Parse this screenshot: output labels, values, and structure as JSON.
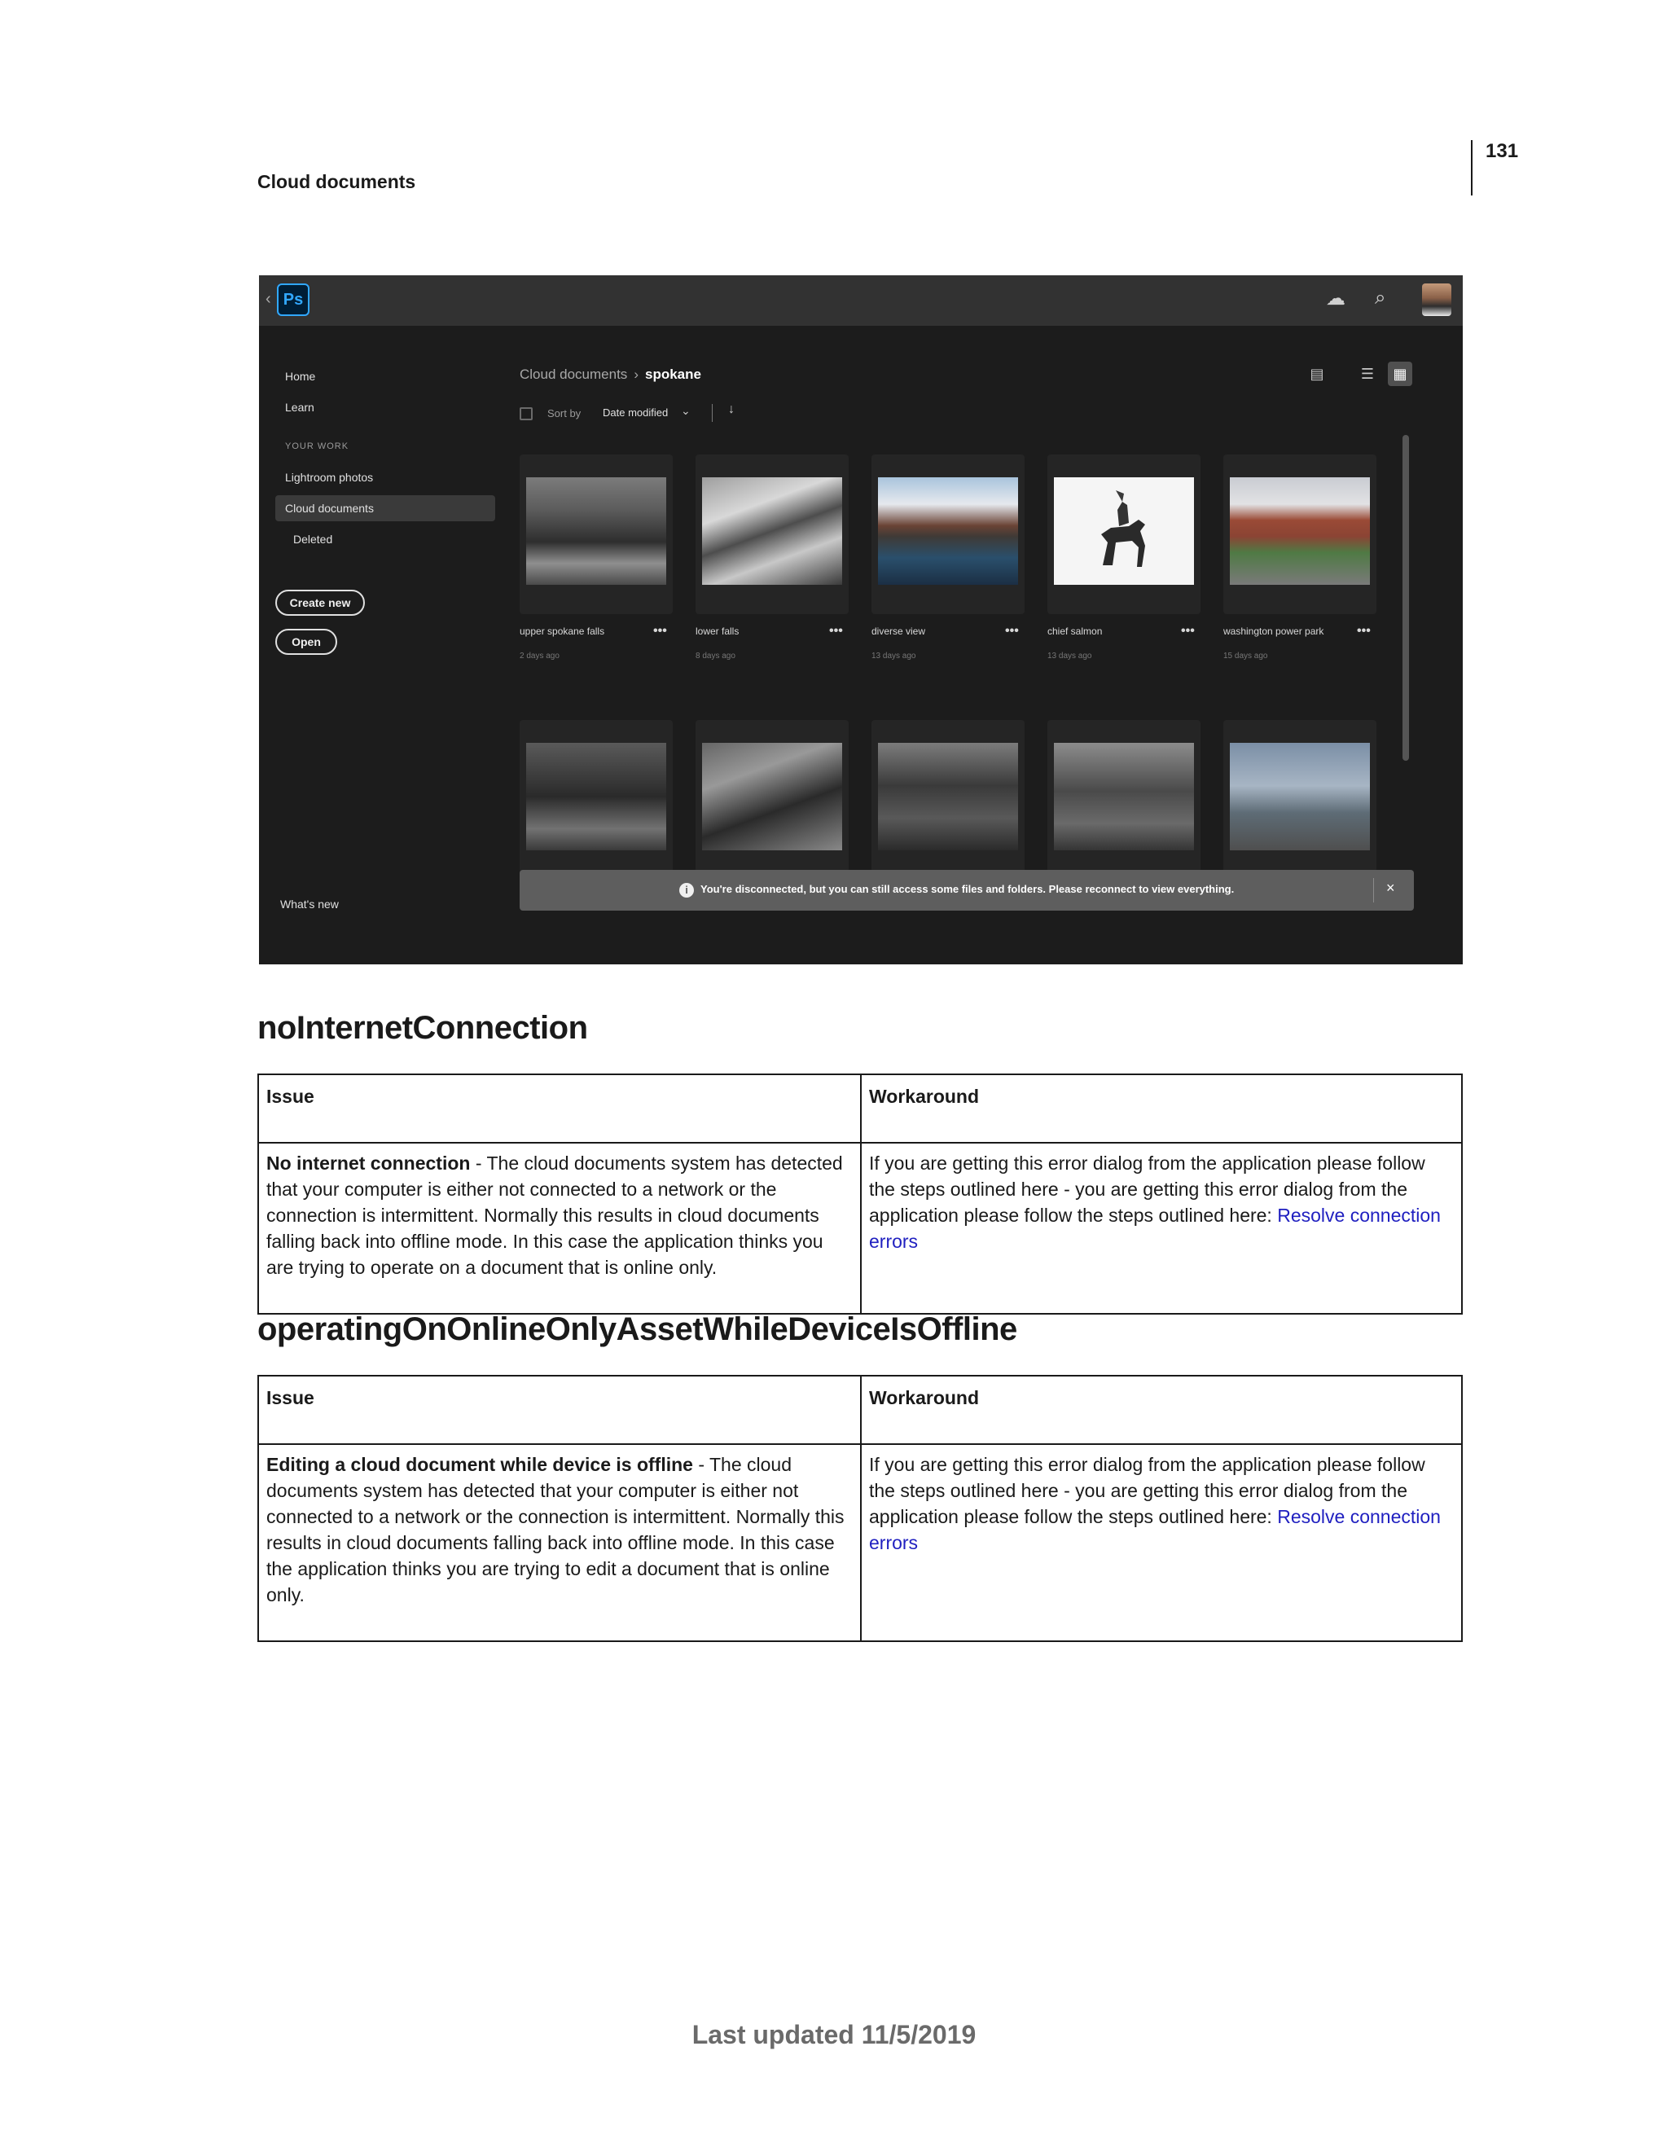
{
  "page": {
    "number": "131",
    "running_head": "Cloud documents",
    "footer": "Last updated 11/5/2019"
  },
  "screenshot": {
    "app_logo": "Ps",
    "sidebar": {
      "home": "Home",
      "learn": "Learn",
      "section": "YOUR WORK",
      "lightroom": "Lightroom photos",
      "cloud_docs": "Cloud documents",
      "deleted": "Deleted",
      "create_new": "Create new",
      "open": "Open",
      "whats_new": "What's new"
    },
    "breadcrumb": {
      "root": "Cloud documents",
      "separator": "›",
      "current": "spokane"
    },
    "sort": {
      "label": "Sort by",
      "value": "Date modified"
    },
    "cards": [
      {
        "title": "upper spokane falls",
        "date": "2 days ago"
      },
      {
        "title": "lower falls",
        "date": "8 days ago"
      },
      {
        "title": "diverse view",
        "date": "13 days ago"
      },
      {
        "title": "chief salmon",
        "date": "13 days ago"
      },
      {
        "title": "washington power park",
        "date": "15 days ago"
      }
    ],
    "toast": {
      "message": "You're disconnected, but you can still access some files and folders. Please reconnect to view everything.",
      "close": "×"
    },
    "colors": {
      "ps_accent": "#31a8ff",
      "ps_bg": "#001e36",
      "app_bg": "#1c1c1c",
      "topbar": "#323232",
      "link": "#2020c0"
    },
    "icons": [
      "cloud-offline-icon",
      "search-icon",
      "folder-icon",
      "list-view-icon",
      "grid-view-icon",
      "info-icon",
      "close-icon"
    ]
  },
  "sections": [
    {
      "heading": "noInternetConnection",
      "col_issue": "Issue",
      "col_workaround": "Workaround",
      "issue_bold": "No internet connection",
      "issue_text": " - The cloud documents system has detected that your computer is either not connected to a network or the connection is intermittent. Normally this results in cloud documents falling back into offline mode. In this case the application thinks you are trying to operate on a document that is online only.",
      "workaround_text": "If you are getting this error dialog from the application please follow the steps outlined here - you are getting this error dialog from the application please follow the steps outlined here: ",
      "workaround_link": "Resolve connection errors"
    },
    {
      "heading": "operatingOnOnlineOnlyAssetWhileDeviceIsOffline",
      "col_issue": "Issue",
      "col_workaround": "Workaround",
      "issue_bold": "Editing a cloud document while device is offline",
      "issue_text": "  - The cloud documents system has detected that your computer is either not connected to a network or the connection is intermittent. Normally this results in cloud documents falling back into offline mode. In this case the application thinks you are trying to edit a document that is online only.",
      "workaround_text": "If you are getting this error dialog from the application please follow the steps outlined here - you are getting this error dialog from the application please follow the steps outlined here: ",
      "workaround_link": "Resolve connection errors"
    }
  ]
}
